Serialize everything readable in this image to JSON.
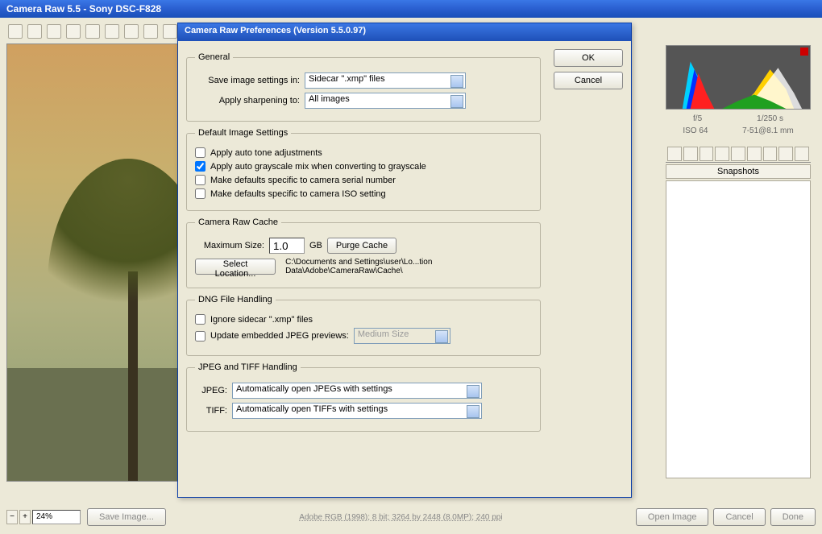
{
  "window": {
    "title": "Camera Raw 5.5  -  Sony DSC-F828"
  },
  "meta": {
    "f": "f/5",
    "shutter": "1/250 s",
    "iso": "ISO 64",
    "focal": "7-51@8.1 mm",
    "footer": "Adobe RGB (1998); 8 bit; 3264 by 2448 (8.0MP); 240 ppi"
  },
  "zoom": {
    "value": "24%"
  },
  "snapshots": {
    "header": "Snapshots"
  },
  "buttons": {
    "save": "Save Image...",
    "open": "Open Image",
    "cancel": "Cancel",
    "done": "Done"
  },
  "dialog": {
    "title": "Camera Raw Preferences  (Version 5.5.0.97)",
    "ok": "OK",
    "cancel": "Cancel",
    "general": {
      "legend": "General",
      "save_label": "Save image settings in:",
      "save_value": "Sidecar \".xmp\" files",
      "sharpen_label": "Apply sharpening to:",
      "sharpen_value": "All images"
    },
    "defaults": {
      "legend": "Default Image Settings",
      "auto_tone": "Apply auto tone adjustments",
      "auto_gray": "Apply auto grayscale mix when converting to grayscale",
      "serial": "Make defaults specific to camera serial number",
      "iso": "Make defaults specific to camera ISO setting"
    },
    "cache": {
      "legend": "Camera Raw Cache",
      "max_label": "Maximum Size:",
      "max_value": "1.0",
      "gb": "GB",
      "purge": "Purge Cache",
      "select": "Select Location...",
      "path": "C:\\Documents and Settings\\user\\Lo...tion Data\\Adobe\\CameraRaw\\Cache\\"
    },
    "dng": {
      "legend": "DNG File Handling",
      "ignore": "Ignore sidecar \".xmp\" files",
      "update_label": "Update embedded JPEG previews:",
      "update_value": "Medium Size"
    },
    "jtiff": {
      "legend": "JPEG and TIFF Handling",
      "jpeg_label": "JPEG:",
      "jpeg_value": "Automatically open JPEGs with settings",
      "tiff_label": "TIFF:",
      "tiff_value": "Automatically open TIFFs with settings"
    }
  }
}
